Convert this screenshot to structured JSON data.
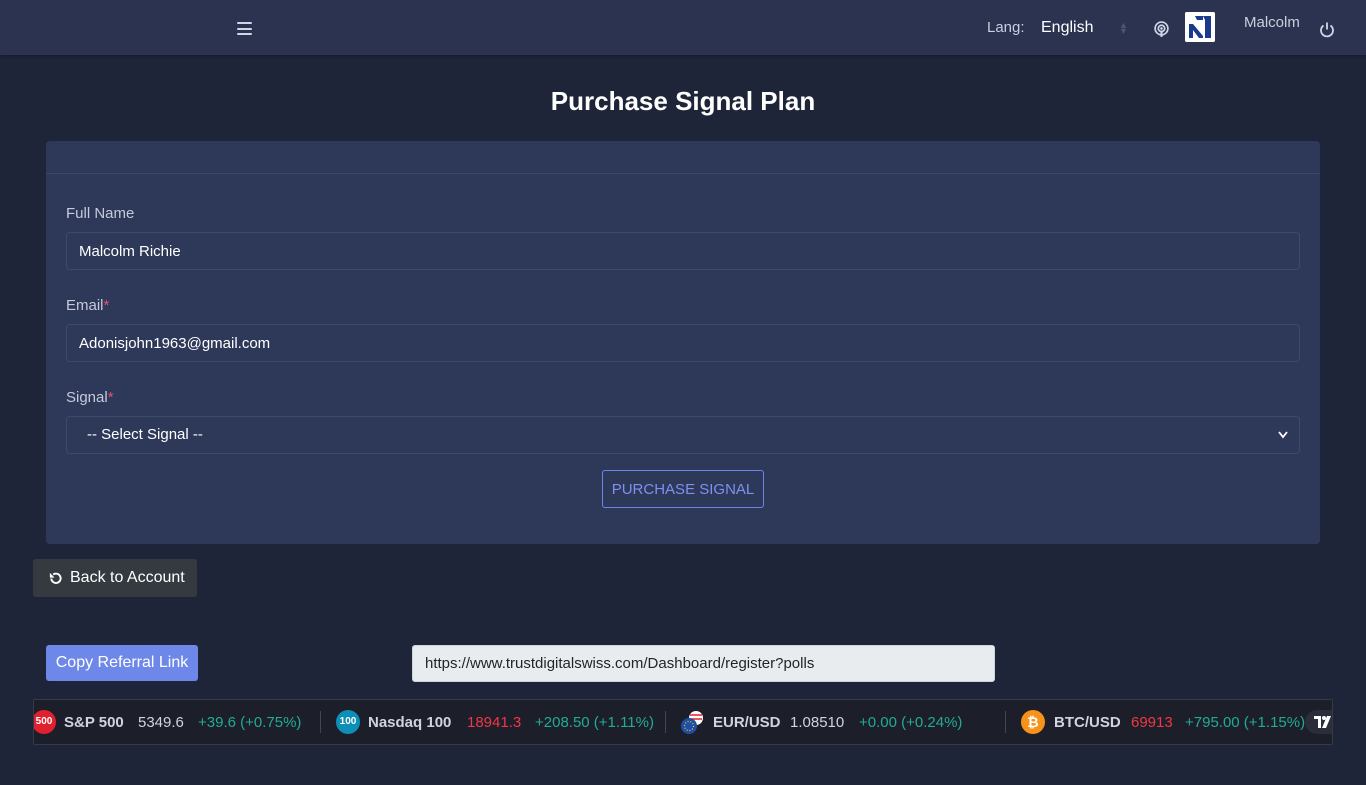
{
  "header": {
    "lang_label": "Lang:",
    "lang_value": "English",
    "user_name": "Malcolm"
  },
  "page": {
    "title": "Purchase Signal Plan"
  },
  "form": {
    "full_name_label": "Full Name",
    "full_name_value": "Malcolm Richie",
    "email_label": "Email",
    "email_value": "Adonisjohn1963@gmail.com",
    "signal_label": "Signal",
    "required_mark": "*",
    "signal_selected": "-- Select Signal --",
    "submit_label": "PURCHASE SIGNAL"
  },
  "back_button": {
    "label": "Back to Account"
  },
  "referral": {
    "copy_label": "Copy Referral Link",
    "link": "https://www.trustdigitalswiss.com/Dashboard/register?polls"
  },
  "ticker": [
    {
      "badge": "500",
      "badge_color": "#e0202f",
      "name": "S&P 500",
      "price": "5349.6",
      "price_trend": "neutral",
      "change": "+39.6 (+0.75%)",
      "change_trend": "up"
    },
    {
      "badge": "100",
      "badge_color": "#0e8fb8",
      "name": "Nasdaq 100",
      "price": "18941.3",
      "price_trend": "down",
      "change": "+208.50 (+1.11%)",
      "change_trend": "up"
    },
    {
      "badge": "",
      "badge_color": "#1e4fa8",
      "name": "EUR/USD",
      "price": "1.08510",
      "price_trend": "neutral",
      "change": "+0.00 (+0.24%)",
      "change_trend": "up"
    },
    {
      "badge": "₿",
      "badge_color": "#f7931a",
      "name": "BTC/USD",
      "price": "69913",
      "price_trend": "down",
      "change": "+795.00 (+1.15%)",
      "change_trend": "up"
    }
  ],
  "colors": {
    "background": "#1f2539",
    "topbar": "#2b3350",
    "card": "#2e3859",
    "accent": "#6e88e9",
    "ticker_up": "#22ab94",
    "ticker_down": "#f23645"
  }
}
